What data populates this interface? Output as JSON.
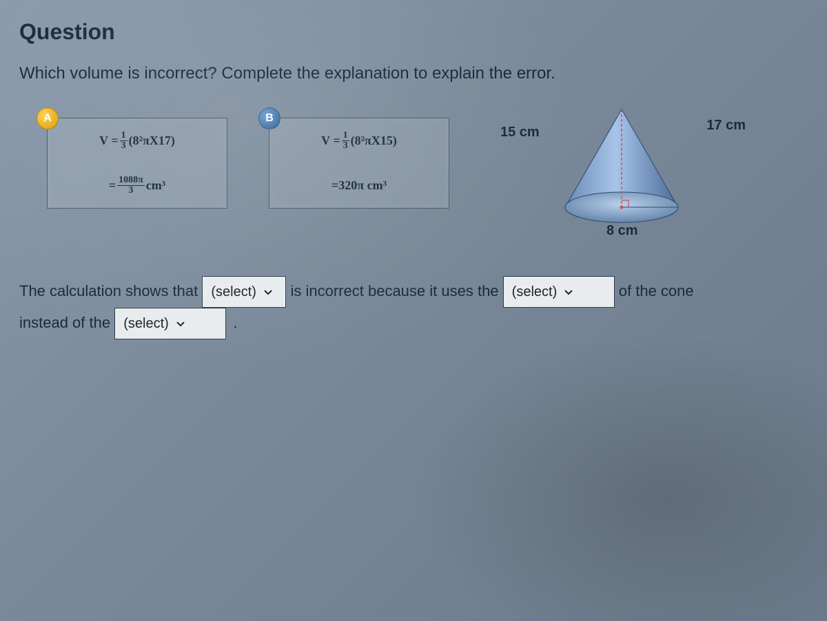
{
  "header": {
    "title": "Question"
  },
  "prompt": "Which volume is incorrect? Complete the explanation to explain the error.",
  "panels": {
    "a": {
      "badge": "A",
      "line1_prefix": "V = ",
      "line1_frac_num": "1",
      "line1_frac_den": "3",
      "line1_suffix": "(8²πX17)",
      "line2_prefix": "= ",
      "line2_frac_num": "1088π",
      "line2_frac_den": "3",
      "line2_suffix": " cm³"
    },
    "b": {
      "badge": "B",
      "line1_prefix": "V = ",
      "line1_frac_num": "1",
      "line1_frac_den": "3",
      "line1_suffix": "(8²πX15)",
      "line2_prefix": "= ",
      "line2_value": "320π cm³"
    }
  },
  "cone": {
    "slant_label": "15 cm",
    "hyp_label": "17 cm",
    "radius_label": "8 cm"
  },
  "sentence": {
    "part1": "The calculation shows that ",
    "part2": " is incorrect because it uses the ",
    "part3": " of the cone",
    "part4": "instead of the ",
    "period": ".",
    "select_placeholder": "(select)"
  }
}
